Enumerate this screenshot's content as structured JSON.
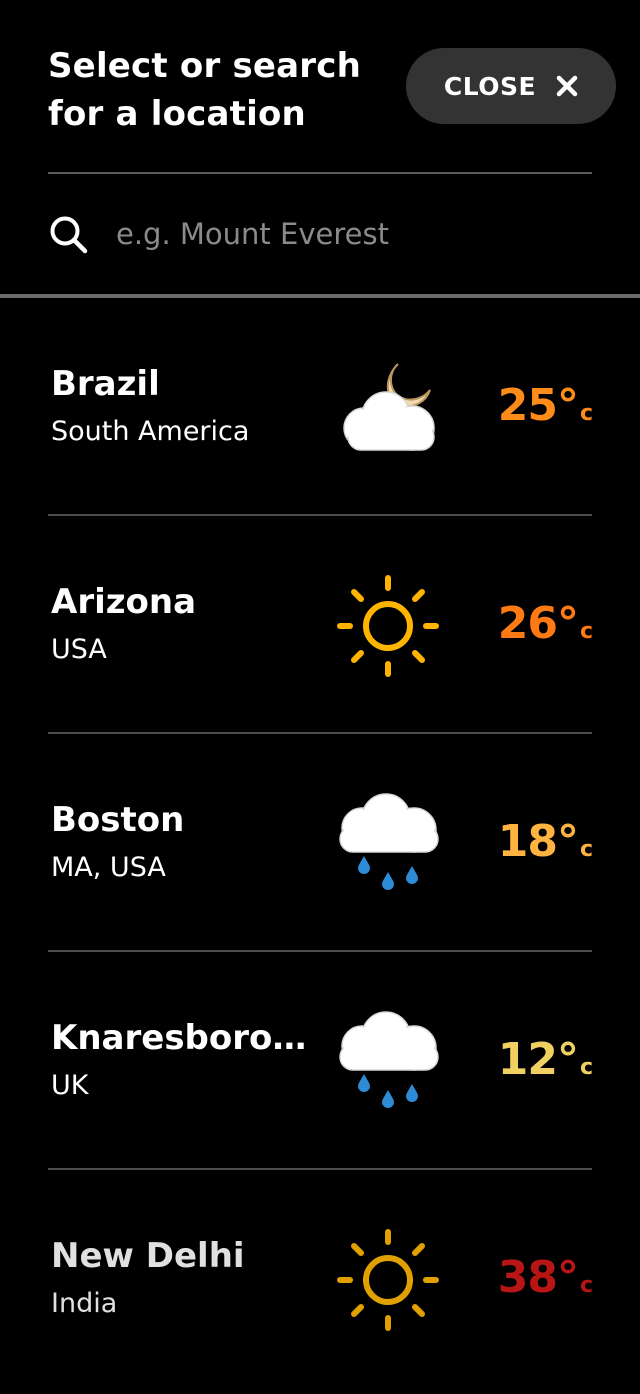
{
  "header": {
    "title": "Select or search for a location",
    "close_label": "CLOSE"
  },
  "search": {
    "placeholder": "e.g. Mount Everest",
    "value": ""
  },
  "locations": [
    {
      "name": "Brazil",
      "region": "South America",
      "weather_icon": "cloudy-night-icon",
      "temp": "25°",
      "unit": "c",
      "temp_color": "#ff8c1a"
    },
    {
      "name": "Arizona",
      "region": "USA",
      "weather_icon": "sunny-icon",
      "temp": "26°",
      "unit": "c",
      "temp_color": "#ff7a12"
    },
    {
      "name": "Boston",
      "region": "MA, USA",
      "weather_icon": "rain-cloud-icon",
      "temp": "18°",
      "unit": "c",
      "temp_color": "#ffb340"
    },
    {
      "name": "Knaresboro...",
      "region": "UK",
      "weather_icon": "rain-cloud-icon",
      "temp": "12°",
      "unit": "c",
      "temp_color": "#f0d060"
    },
    {
      "name": "New Delhi",
      "region": "India",
      "weather_icon": "sunny-icon",
      "temp": "38°",
      "unit": "c",
      "temp_color": "#b81515"
    }
  ],
  "colors": {
    "background": "#000000",
    "close_button_bg": "#333333",
    "sun": "#ffb400",
    "cloud": "#ffffff",
    "rain": "#2e8bd6",
    "moon": "#f5deb3"
  }
}
